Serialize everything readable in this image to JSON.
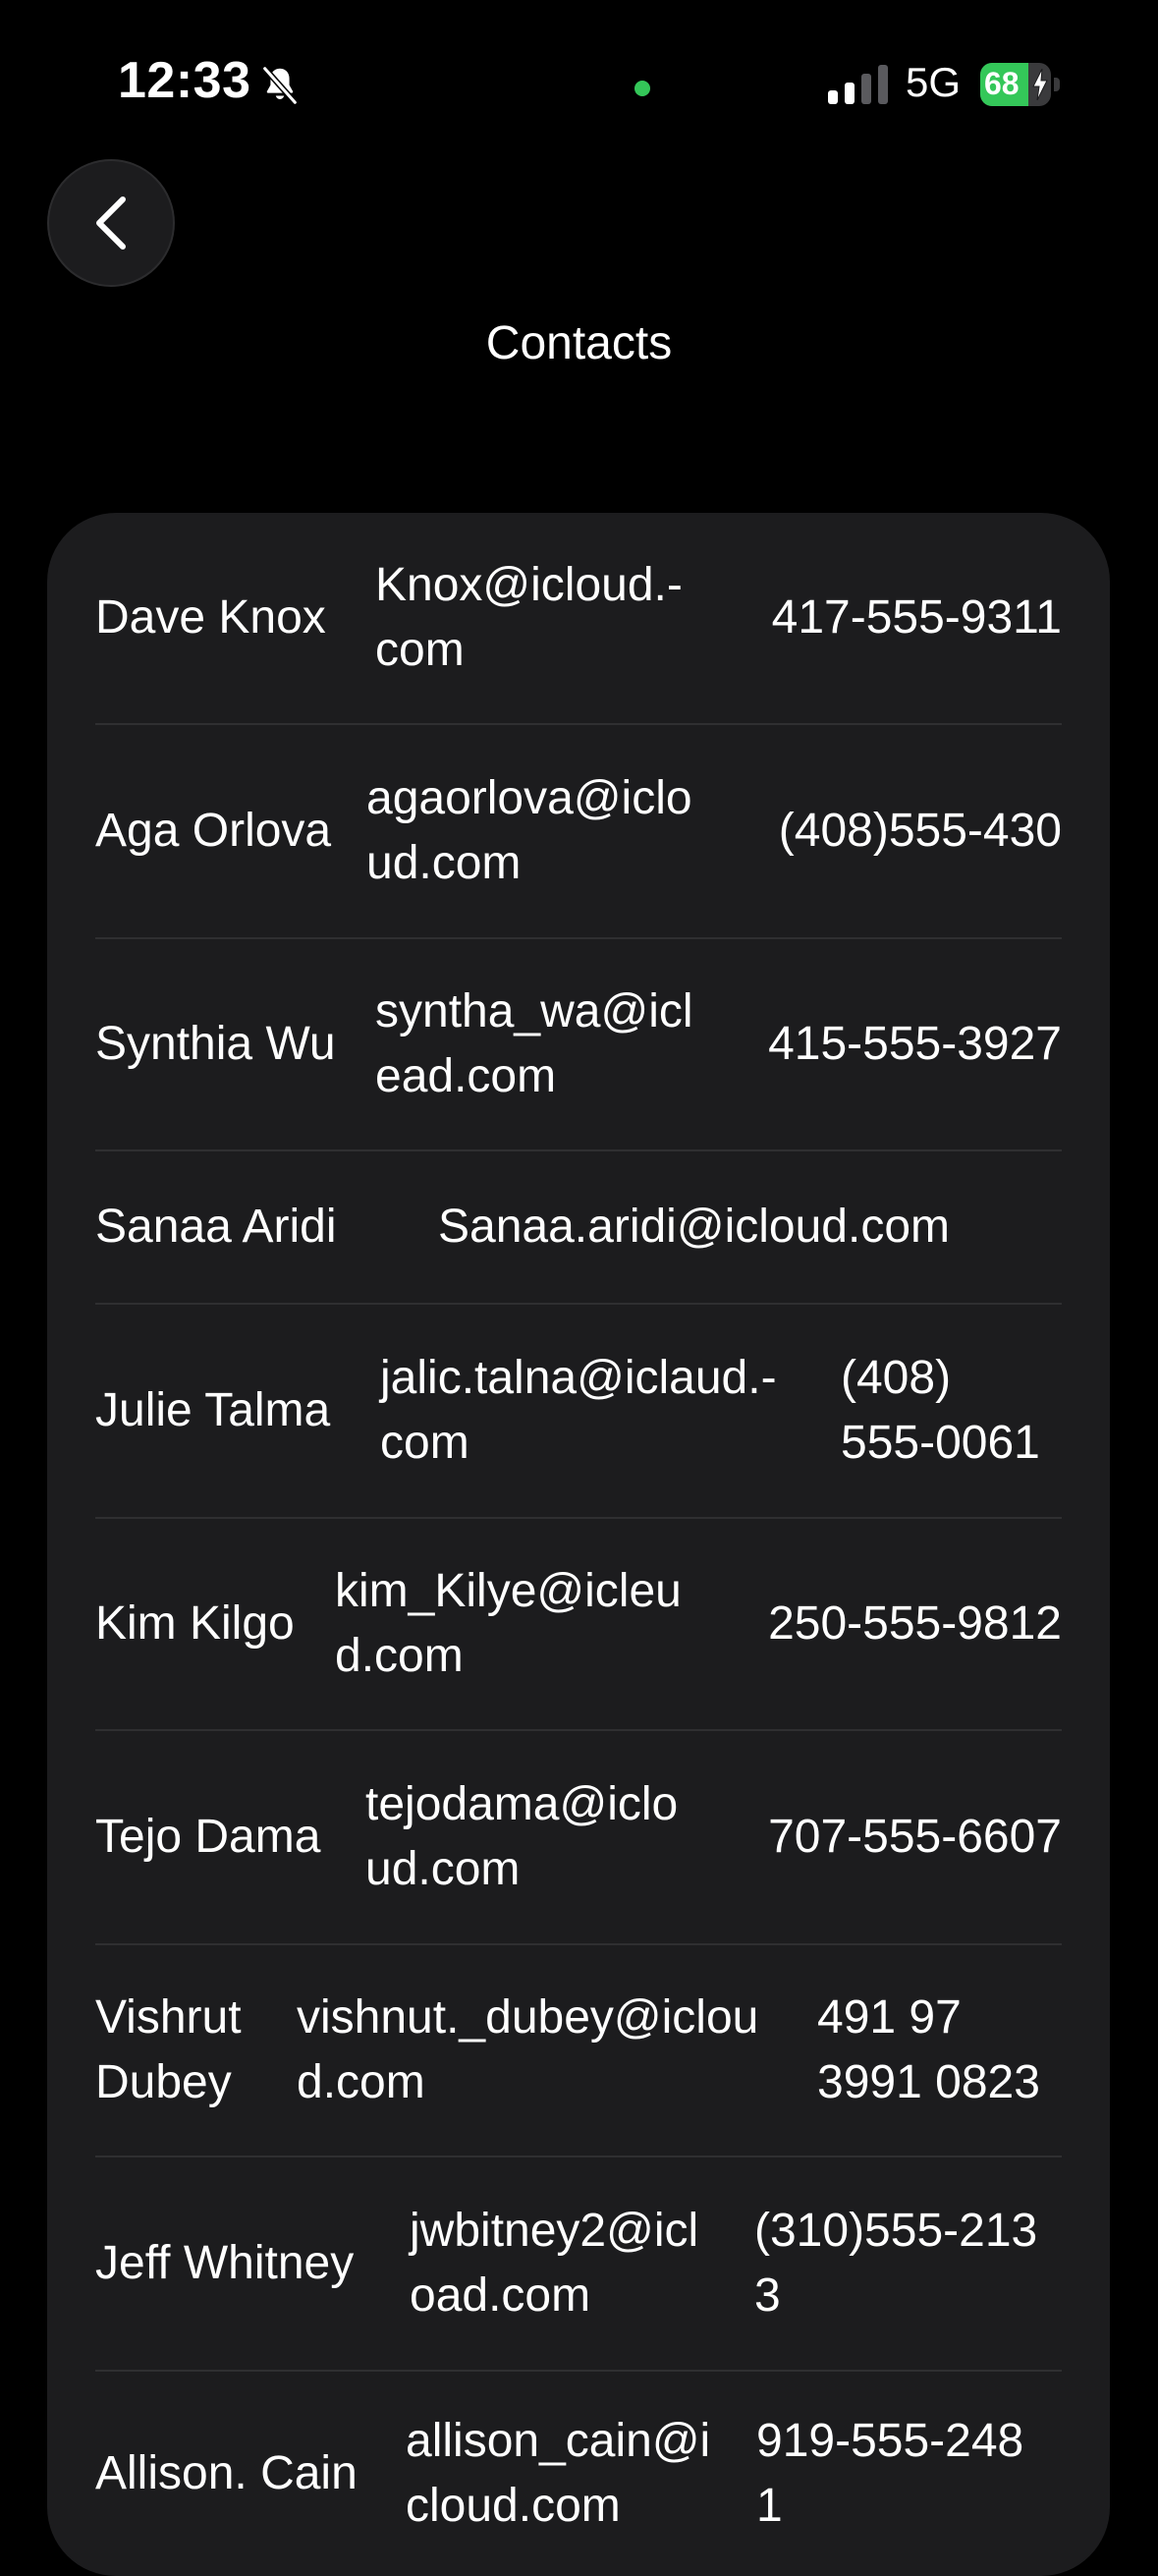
{
  "status_bar": {
    "time": "12:33",
    "network": "5G",
    "battery_level": "68",
    "battery_fraction": 0.68,
    "accent_green": "#34c759",
    "icons": [
      "bell-slash-icon",
      "cellular-signal-icon",
      "battery-charging-icon"
    ]
  },
  "header": {
    "back_icon": "chevron-left-icon",
    "title": "Contacts"
  },
  "contacts": [
    {
      "name": "Dave Knox",
      "email": "Knox@icloud.-\ncom",
      "phone": "417-555-9311"
    },
    {
      "name": "Aga Orlova",
      "email": "agaorlova@iclo\nud.com",
      "phone": "(408)555-430"
    },
    {
      "name": "Synthia Wu",
      "email": "syntha_wa@icl\nead.com",
      "phone": "415-555-3927"
    },
    {
      "name": "Sanaa Aridi",
      "email": "Sanaa.aridi@icloud.com",
      "phone": ""
    },
    {
      "name": "Julie Talma",
      "email": "jalic.talna@iclaud.-\ncom",
      "phone": "(408)\n555-0061"
    },
    {
      "name": "Kim Kilgo",
      "email": "kim_Kilye@icleu\nd.com",
      "phone": "250-555-9812"
    },
    {
      "name": "Tejo Dama",
      "email": "tejodama@iclo\nud.com",
      "phone": "707-555-6607"
    },
    {
      "name": "Vishrut\nDubey",
      "email": "vishnut._dubey@iclou\nd.com",
      "phone": "491 97\n3991 0823"
    },
    {
      "name": "Jeff Whitney",
      "email": "jwbitney2@icl\noad.com",
      "phone": "(310)555-213\n3"
    },
    {
      "name": "Allison. Cain",
      "email": "allison_cain@i\ncloud.com",
      "phone": "919-555-248\n1"
    }
  ]
}
